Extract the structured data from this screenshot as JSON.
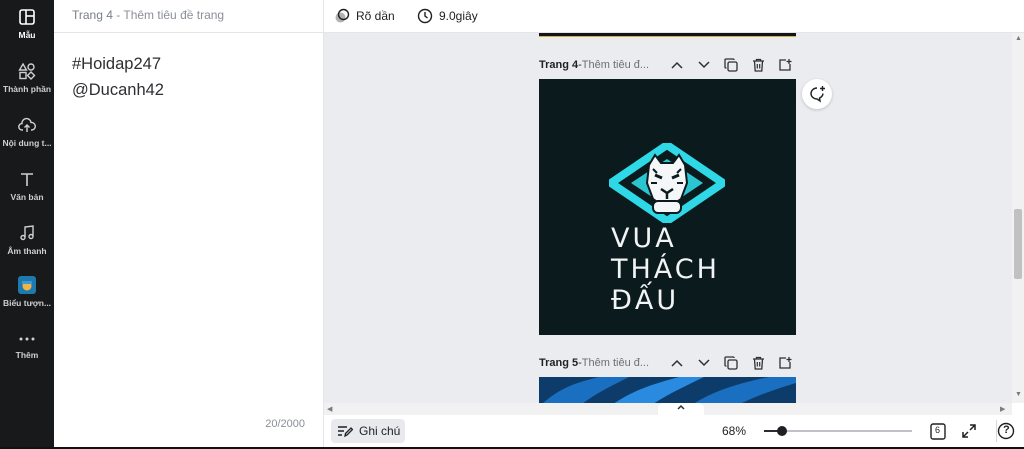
{
  "sidebar": {
    "items": [
      {
        "label": "Mẫu",
        "icon": "template-icon",
        "active": true
      },
      {
        "label": "Thành phần",
        "icon": "elements-icon"
      },
      {
        "label": "Nội dung t...",
        "icon": "upload-icon"
      },
      {
        "label": "Văn bản",
        "icon": "text-icon"
      },
      {
        "label": "Âm thanh",
        "icon": "music-icon"
      },
      {
        "label": "Biểu tượn...",
        "icon": "brand-icon"
      },
      {
        "label": "Thêm",
        "icon": "more-icon"
      }
    ]
  },
  "notes": {
    "header_page": "Trang 4",
    "header_sep": " - ",
    "header_title": "Thêm tiêu đề trang",
    "line1": "#Hoidap247",
    "line2": "@Ducanh42",
    "char_count": "20/2000"
  },
  "toolbar": {
    "transition_label": "Rõ dần",
    "duration_label": "9.0giây"
  },
  "pages": [
    {
      "label": "Trang 4",
      "sep": " - ",
      "subtitle": "Thêm tiêu đ...",
      "slide_lines": [
        "VUA",
        "THÁCH",
        "ĐẤU"
      ]
    },
    {
      "label": "Trang 5",
      "sep": " - ",
      "subtitle": "Thêm tiêu đ..."
    }
  ],
  "bottom_bar": {
    "notes_label": "Ghi chú",
    "zoom": "68%",
    "zoom_fraction": 0.12,
    "page_count": "6",
    "help": "?"
  },
  "colors": {
    "rail_bg": "#18191b",
    "slide_bg": "#0b1a1c",
    "logo_cyan": "#2ed8e6",
    "page5_bg": "#0d3c6b"
  }
}
